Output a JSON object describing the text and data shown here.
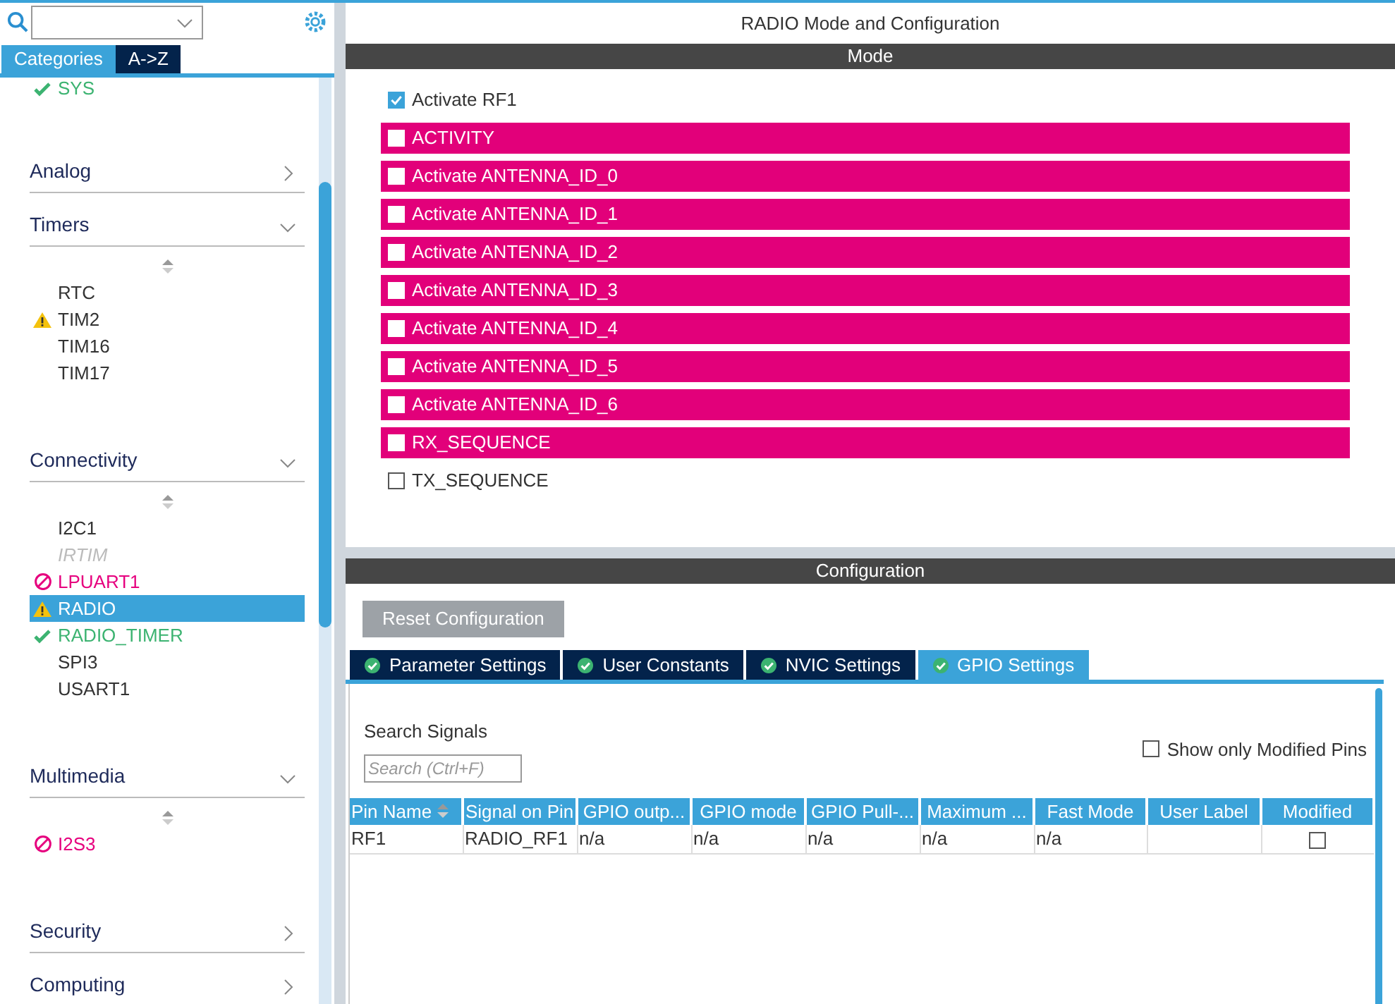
{
  "sidebar": {
    "tabs": [
      {
        "label": "Categories",
        "selected": true
      },
      {
        "label": "A->Z",
        "selected": false
      }
    ],
    "top_items": [
      {
        "label": "SYS",
        "kind": "ok",
        "selected": false
      }
    ],
    "categories": [
      {
        "label": "Analog",
        "expanded": false
      },
      {
        "label": "Timers",
        "expanded": true,
        "items": [
          {
            "label": "RTC",
            "kind": "plain",
            "selected": false
          },
          {
            "label": "TIM2",
            "kind": "warn",
            "selected": false
          },
          {
            "label": "TIM16",
            "kind": "plain",
            "selected": false
          },
          {
            "label": "TIM17",
            "kind": "plain",
            "selected": false
          }
        ]
      },
      {
        "label": "Connectivity",
        "expanded": true,
        "items": [
          {
            "label": "I2C1",
            "kind": "plain",
            "selected": false
          },
          {
            "label": "IRTIM",
            "kind": "disabled",
            "selected": false
          },
          {
            "label": "LPUART1",
            "kind": "blocked",
            "selected": false
          },
          {
            "label": "RADIO",
            "kind": "warn",
            "selected": true
          },
          {
            "label": "RADIO_TIMER",
            "kind": "ok",
            "selected": false
          },
          {
            "label": "SPI3",
            "kind": "plain",
            "selected": false
          },
          {
            "label": "USART1",
            "kind": "plain",
            "selected": false
          }
        ]
      },
      {
        "label": "Multimedia",
        "expanded": true,
        "items": [
          {
            "label": "I2S3",
            "kind": "blocked",
            "selected": false
          }
        ]
      },
      {
        "label": "Security",
        "expanded": false
      },
      {
        "label": "Computing",
        "expanded": false
      }
    ]
  },
  "main": {
    "title": "RADIO Mode and Configuration",
    "mode": {
      "header": "Mode",
      "options": [
        {
          "label": "Activate RF1",
          "checked": true,
          "highlighted": false
        },
        {
          "label": "ACTIVITY",
          "checked": false,
          "highlighted": true
        },
        {
          "label": "Activate ANTENNA_ID_0",
          "checked": false,
          "highlighted": true
        },
        {
          "label": "Activate ANTENNA_ID_1",
          "checked": false,
          "highlighted": true
        },
        {
          "label": "Activate ANTENNA_ID_2",
          "checked": false,
          "highlighted": true
        },
        {
          "label": "Activate ANTENNA_ID_3",
          "checked": false,
          "highlighted": true
        },
        {
          "label": "Activate ANTENNA_ID_4",
          "checked": false,
          "highlighted": true
        },
        {
          "label": "Activate ANTENNA_ID_5",
          "checked": false,
          "highlighted": true
        },
        {
          "label": "Activate ANTENNA_ID_6",
          "checked": false,
          "highlighted": true
        },
        {
          "label": "RX_SEQUENCE",
          "checked": false,
          "highlighted": true
        },
        {
          "label": "TX_SEQUENCE",
          "checked": false,
          "highlighted": false
        }
      ]
    },
    "configuration": {
      "header": "Configuration",
      "reset_button": "Reset Configuration",
      "tabs": [
        {
          "label": "Parameter Settings",
          "selected": false
        },
        {
          "label": "User Constants",
          "selected": false
        },
        {
          "label": "NVIC Settings",
          "selected": false
        },
        {
          "label": "GPIO Settings",
          "selected": true
        }
      ],
      "search_label": "Search Signals",
      "search": {
        "placeholder": "Search (Ctrl+F)"
      },
      "show_modified": {
        "label": "Show only Modified Pins",
        "checked": false
      },
      "table": {
        "columns": [
          "Pin Name",
          "Signal on Pin",
          "GPIO outp...",
          "GPIO mode",
          "GPIO Pull-...",
          "Maximum ...",
          "Fast Mode",
          "User Label",
          "Modified"
        ],
        "rows": [
          {
            "cells": [
              "RF1",
              "RADIO_RF1",
              "n/a",
              "n/a",
              "n/a",
              "n/a",
              "n/a"
            ],
            "modified": false
          }
        ]
      }
    }
  }
}
